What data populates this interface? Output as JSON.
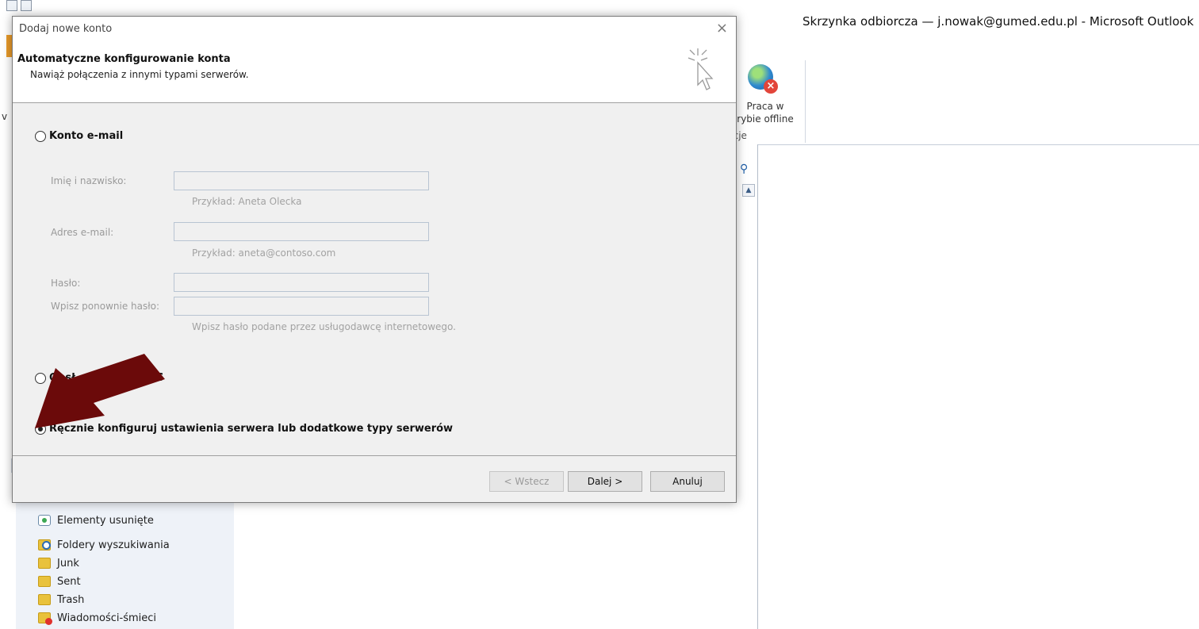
{
  "window": {
    "title": "Skrzynka odbiorcza — j.nowak@gumed.edu.pl  -  Microsoft Outlook"
  },
  "ribbon": {
    "offline_button_label_line1": "Praca w",
    "offline_button_label_line2": "rybie offline",
    "group_label": "ncje",
    "left_clip": "v"
  },
  "nav": {
    "items": [
      {
        "label": "Elementy usunięte",
        "icon": "deleted-items-icon"
      },
      {
        "label": "Foldery wyszukiwania",
        "icon": "search-folder-icon"
      },
      {
        "label": "Junk",
        "icon": "folder-icon"
      },
      {
        "label": "Sent",
        "icon": "folder-icon"
      },
      {
        "label": "Trash",
        "icon": "folder-icon"
      },
      {
        "label": "Wiadomości-śmieci",
        "icon": "junk-folder-icon"
      }
    ]
  },
  "dialog": {
    "title": "Dodaj nowe konto",
    "close": "×",
    "heading": "Automatyczne konfigurowanie konta",
    "subheading": "Nawiąż połączenia z innymi typami serwerów.",
    "options": [
      {
        "label": "Konto e-mail",
        "checked": false
      },
      {
        "label": "Obsługa wiadomości SMS",
        "visible_label": "Obsł              ci SMS",
        "checked": false
      },
      {
        "label": "Ręcznie konfiguruj ustawienia serwera lub dodatkowe typy serwerów",
        "checked": true
      }
    ],
    "fields": {
      "name_label": "Imię i nazwisko:",
      "name_hint": "Przykład: Aneta Olecka",
      "email_label": "Adres e-mail:",
      "email_hint": "Przykład: aneta@contoso.com",
      "password_label": "Hasło:",
      "password_confirm_label": "Wpisz ponownie hasło:",
      "password_hint": "Wpisz hasło podane przez usługodawcę internetowego."
    },
    "buttons": {
      "back": "< Wstecz",
      "next": "Dalej >",
      "cancel": "Anuluj"
    }
  },
  "colors": {
    "arrow": "#6b0a0a",
    "dialog_bg": "#f0f0f0",
    "nav_bg": "#eef2f8"
  }
}
